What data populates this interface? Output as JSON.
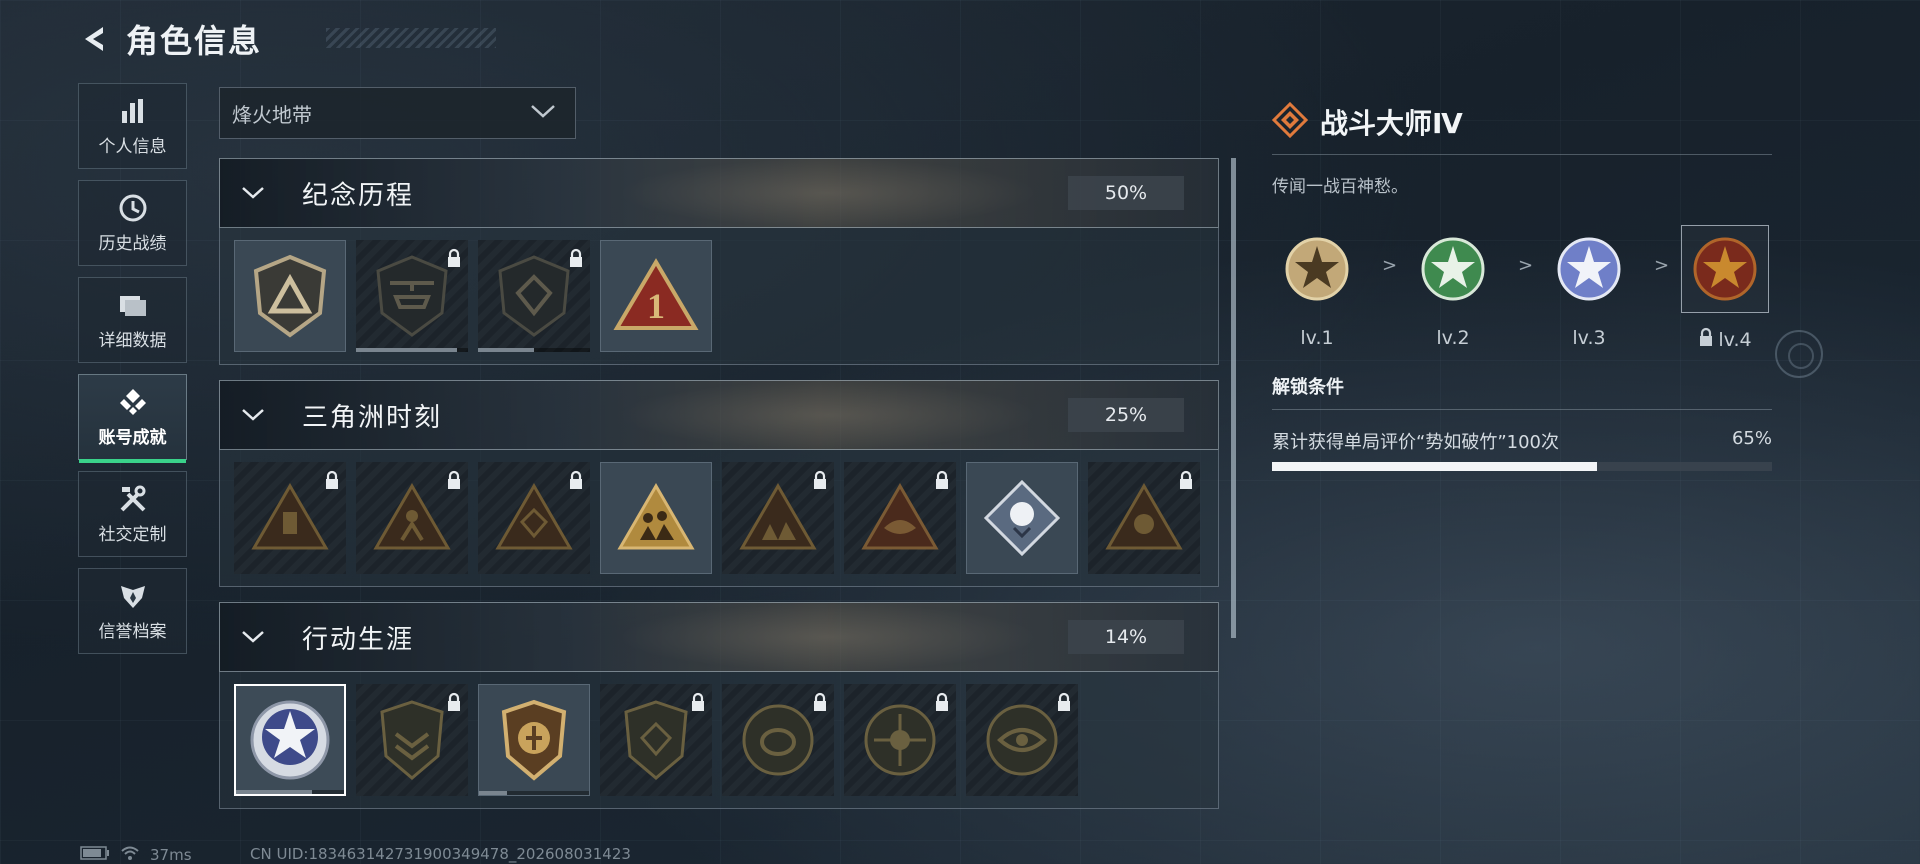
{
  "header": {
    "title": "角色信息"
  },
  "sidebar": {
    "items": [
      {
        "label": "个人信息",
        "icon": "bar-chart-icon"
      },
      {
        "label": "历史战绩",
        "icon": "clock-icon"
      },
      {
        "label": "详细数据",
        "icon": "folder-icon"
      },
      {
        "label": "账号成就",
        "icon": "achievement-icon",
        "active": true
      },
      {
        "label": "社交定制",
        "icon": "tools-icon"
      },
      {
        "label": "信誉档案",
        "icon": "wing-badge-icon"
      }
    ]
  },
  "mode_select": {
    "value": "烽火地带"
  },
  "sections": [
    {
      "name": "纪念历程",
      "percent": "50%",
      "badges": [
        {
          "icon": "shield-triangle-badge",
          "locked": false,
          "owned": true
        },
        {
          "icon": "helicopter-badge",
          "locked": true,
          "progress": 0.9
        },
        {
          "icon": "hex-shield-badge",
          "locked": true,
          "progress": 0.5
        },
        {
          "icon": "red-number-one-badge",
          "locked": false,
          "owned": true
        }
      ]
    },
    {
      "name": "三角洲时刻",
      "percent": "25%",
      "badges": [
        {
          "icon": "usb-triangle-badge",
          "locked": true
        },
        {
          "icon": "runner-triangle-badge",
          "locked": true
        },
        {
          "icon": "dice-triangle-badge",
          "locked": true
        },
        {
          "icon": "squad-triangle-badge",
          "locked": false,
          "owned": true
        },
        {
          "icon": "crowd-triangle-badge",
          "locked": true
        },
        {
          "icon": "fish-triangle-badge",
          "locked": true
        },
        {
          "icon": "rose-diamond-badge",
          "locked": false,
          "owned": true
        },
        {
          "icon": "skull-triangle-badge",
          "locked": true
        }
      ]
    },
    {
      "name": "行动生涯",
      "percent": "14%",
      "badges": [
        {
          "icon": "star-medal-badge",
          "locked": false,
          "selected": true,
          "progress": 0.7
        },
        {
          "icon": "chevron-shield-badge",
          "locked": true
        },
        {
          "icon": "gold-shield-badge",
          "locked": false,
          "owned": true,
          "progress": 0.25
        },
        {
          "icon": "dice-shield-badge",
          "locked": true
        },
        {
          "icon": "shell-coin-badge",
          "locked": true
        },
        {
          "icon": "crosshair-skull-badge",
          "locked": true
        },
        {
          "icon": "eye-coin-badge",
          "locked": true
        }
      ]
    }
  ],
  "detail": {
    "title": "战斗大师Ⅳ",
    "description": "传闻一战百神愁。",
    "levels": [
      {
        "label": "lv.1",
        "color": "#c2a878"
      },
      {
        "label": "lv.2",
        "color": "#3f8a4f"
      },
      {
        "label": "lv.3",
        "color": "#6f7fc8"
      },
      {
        "label": "lv.4",
        "color": "#b0652a",
        "locked": true,
        "current": true
      }
    ],
    "unlock_title": "解锁条件",
    "condition": {
      "text": "累计获得单局评价“势如破竹”100次",
      "percent": "65%",
      "progress": 0.65
    }
  },
  "status": {
    "ping": "37ms",
    "uid": "CN UID:183463142731900349478_202608031423"
  },
  "colors": {
    "accent_green": "#3ad28a",
    "detail_icon": "#e07a3c"
  }
}
